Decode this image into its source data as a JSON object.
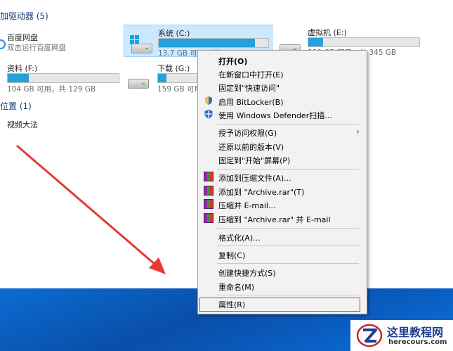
{
  "explorer": {
    "devices_header": "加驱动器 (5)",
    "locations_header": "位置 (1)",
    "drives": [
      {
        "name": "百度网盘",
        "sub": "双击运行百度网盘"
      },
      {
        "name": "系统 (C:)",
        "sub": "13.7 GB 可用，共 119 GB",
        "fill": 0.88
      },
      {
        "name": "虚拟机 (E:)",
        "sub": "299 GB 可用，共 345 GB",
        "fill": 0.13
      },
      {
        "name": "资料 (F:)",
        "sub": "104 GB 可用，共 129 GB",
        "fill": 0.19
      },
      {
        "name": "下载 (G:)",
        "sub": "159 GB 可用，共 201 GB",
        "fill": 0.21
      }
    ],
    "locations": [
      {
        "name": "视频大法"
      }
    ]
  },
  "menu": {
    "items": [
      {
        "label": "打开(O)"
      },
      {
        "label": "在新窗口中打开(E)"
      },
      {
        "label": "固定到\"快速访问\""
      },
      {
        "label": "启用 BitLocker(B)"
      },
      {
        "label": "使用 Windows Defender扫描..."
      },
      {
        "label": "授予访问权限(G)"
      },
      {
        "label": "还原以前的版本(V)"
      },
      {
        "label": "固定到\"开始\"屏幕(P)"
      },
      {
        "label": "添加到压缩文件(A)..."
      },
      {
        "label": "添加到 \"Archive.rar\"(T)"
      },
      {
        "label": "压缩并 E-mail..."
      },
      {
        "label": "压缩到 \"Archive.rar\" 并 E-mail"
      },
      {
        "label": "格式化(A)..."
      },
      {
        "label": "复制(C)"
      },
      {
        "label": "创建快捷方式(S)"
      },
      {
        "label": "重命名(M)"
      },
      {
        "label": "属性(R)"
      }
    ]
  },
  "watermark": {
    "title": "这里教程网",
    "url": "herecours.com"
  },
  "colors": {
    "accent": "#26a0da",
    "highlight_border": "#e03535",
    "arrow": "#e53935",
    "taskbar": "#0a5cc0"
  }
}
